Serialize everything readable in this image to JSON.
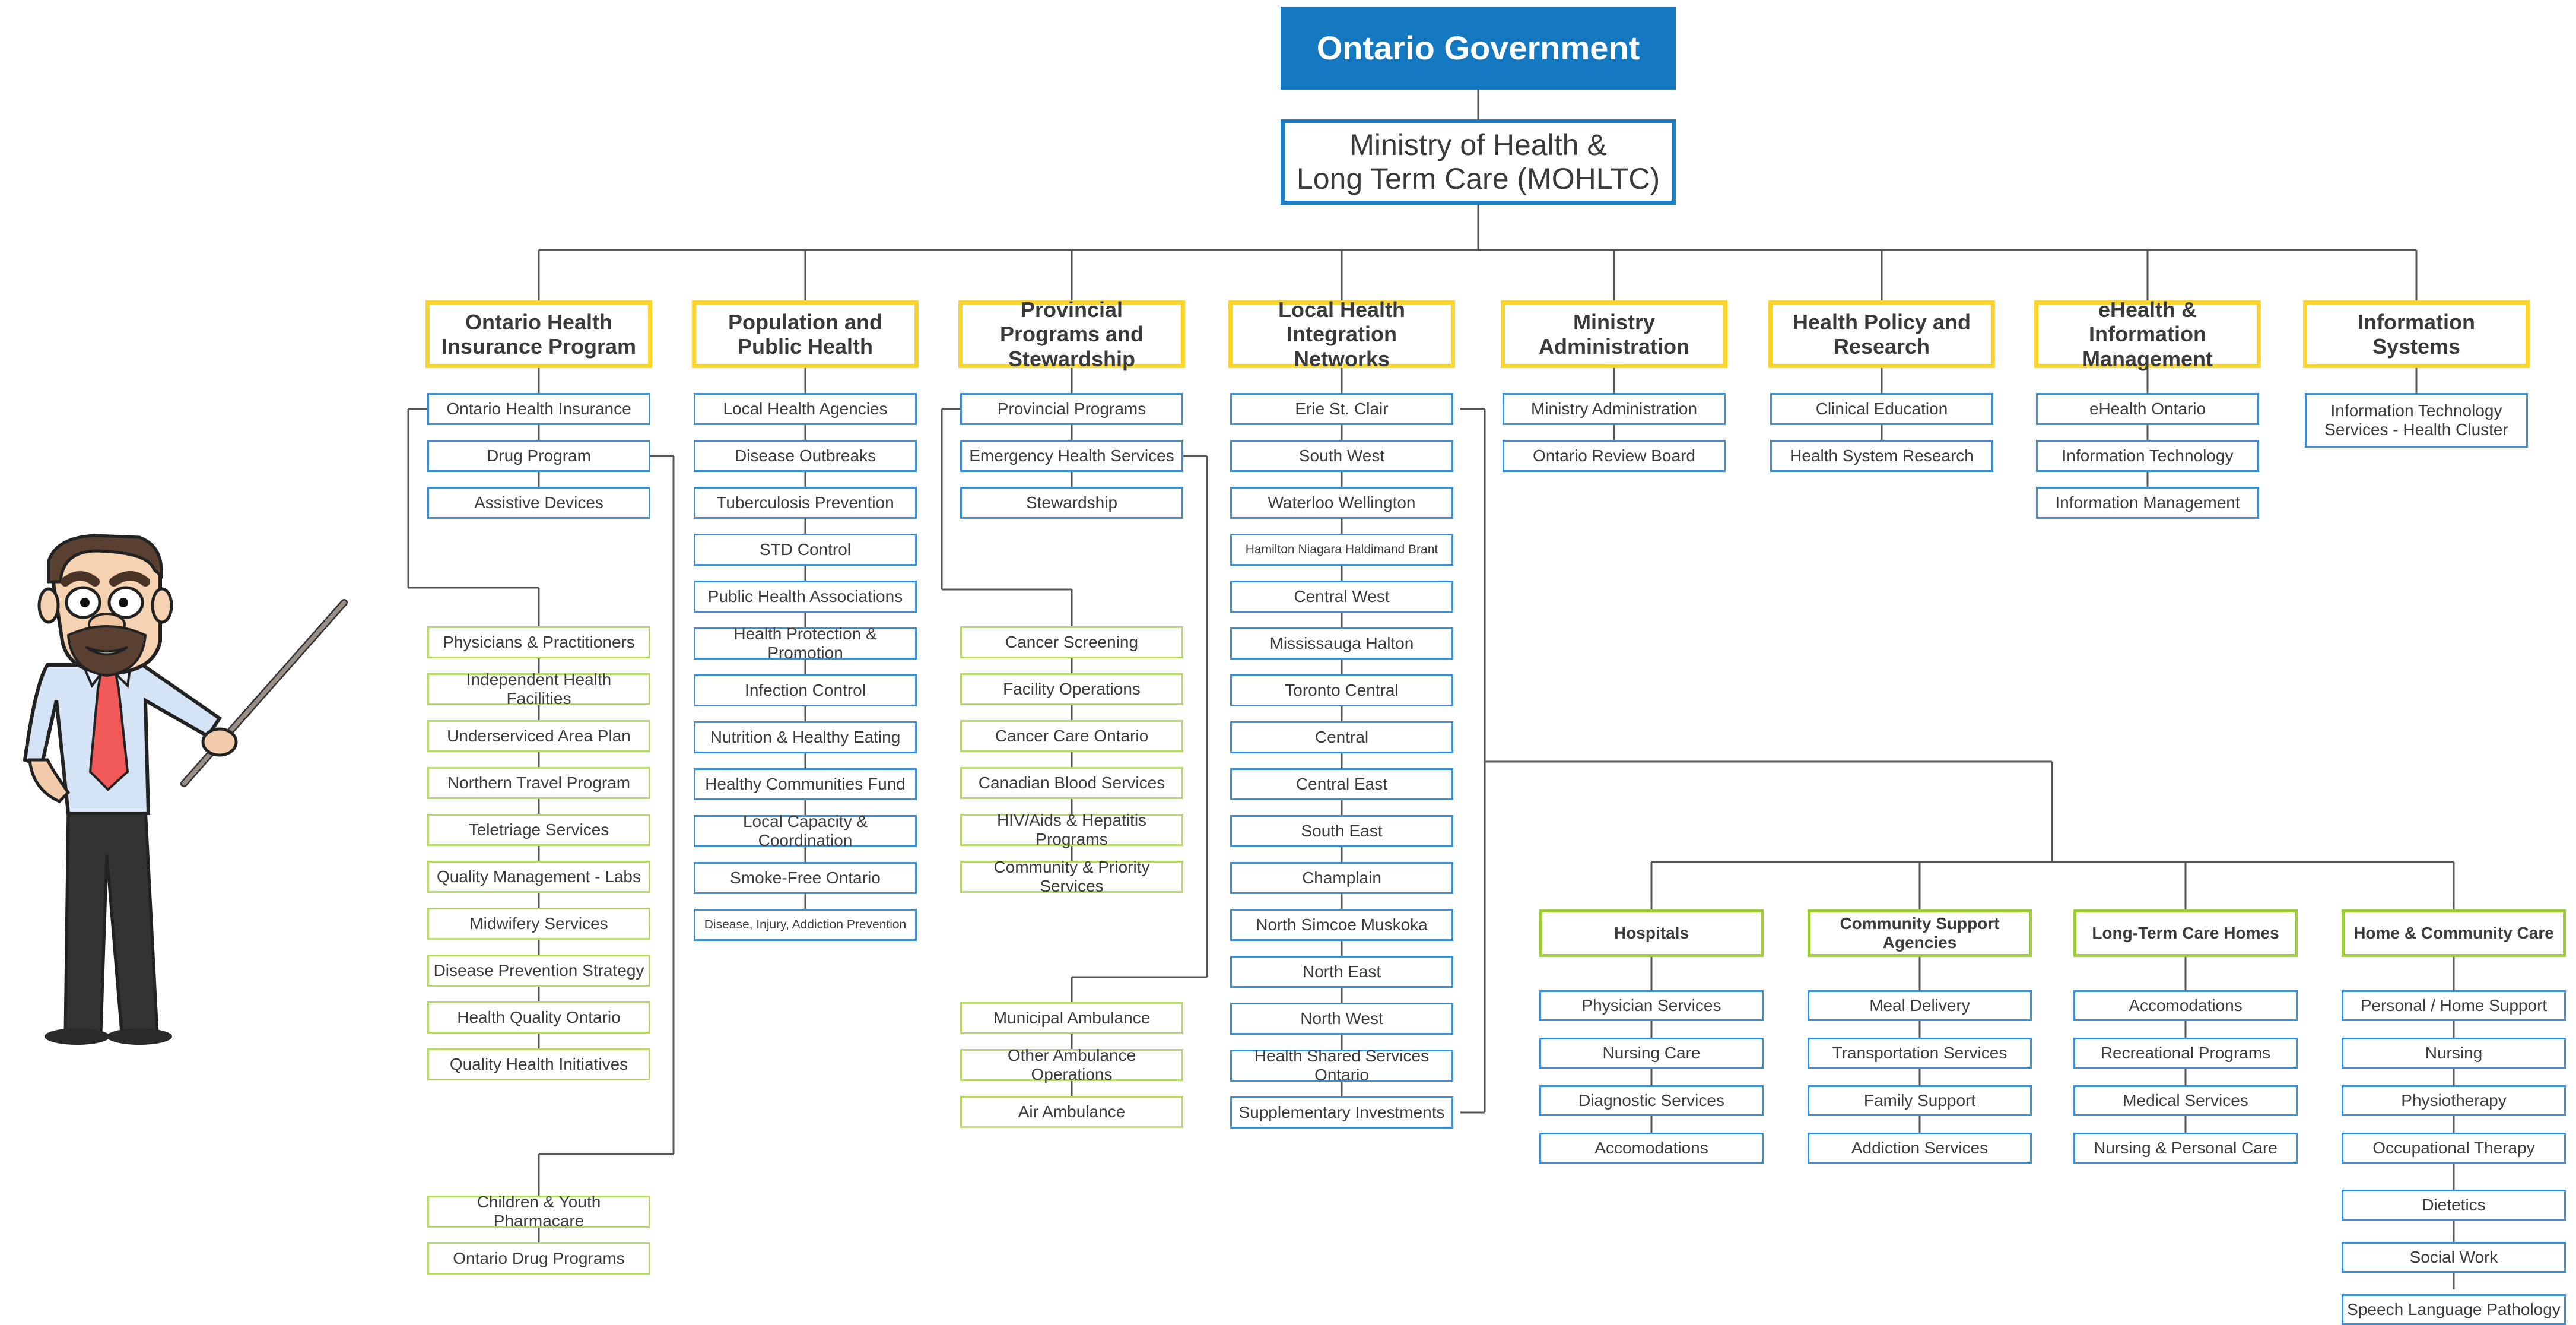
{
  "root": {
    "label": "Ontario Government"
  },
  "ministry": {
    "label": "Ministry of Health & Long Term Care (MOHLTC)",
    "line1": "Ministry of Health &",
    "line2": "Long Term Care (MOHLTC)"
  },
  "colors": {
    "root_fill": "#1479c1",
    "ministry_border": "#1f7fc4",
    "tier1_border": "#fbd52e",
    "leaf_blue_border": "#3d8fd1",
    "leaf_green_border": "#b6d96a",
    "subgroup_border": "#9fcd3a",
    "connector": "#555555"
  },
  "divisions": [
    {
      "label": "Ontario Health Insurance Program",
      "children": [
        "Ontario Health Insurance",
        "Drug Program",
        "Assistive Devices"
      ],
      "ohi_programs": [
        "Physicians & Practitioners",
        "Independent Health Facilities",
        "Underserviced Area Plan",
        "Northern Travel Program",
        "Teletriage Services",
        "Quality Management - Labs",
        "Midwifery Services",
        "Disease Prevention Strategy",
        "Health Quality Ontario",
        "Quality Health Initiatives"
      ],
      "drug_programs": [
        "Children & Youth Pharmacare",
        "Ontario Drug Programs"
      ]
    },
    {
      "label": "Population and Public Health",
      "children": [
        "Local Health Agencies",
        "Disease Outbreaks",
        "Tuberculosis Prevention",
        "STD Control",
        "Public Health Associations",
        "Health Protection & Promotion",
        "Infection Control",
        "Nutrition & Healthy Eating",
        "Healthy Communities Fund",
        "Local Capacity & Coordination",
        "Smoke-Free Ontario",
        "Disease, Injury, Addiction Prevention"
      ]
    },
    {
      "label": "Provincial Programs and Stewardship",
      "children": [
        "Provincial Programs",
        "Emergency Health Services",
        "Stewardship"
      ],
      "provincial_programs": [
        "Cancer Screening",
        "Facility Operations",
        "Cancer Care Ontario",
        "Canadian Blood Services",
        "HIV/Aids & Hepatitis Programs",
        "Community & Priority Services"
      ],
      "emergency_services": [
        "Municipal Ambulance",
        "Other Ambulance Operations",
        "Air Ambulance"
      ]
    },
    {
      "label": "Local Health Integration Networks",
      "children": [
        "Erie St. Clair",
        "South West",
        "Waterloo Wellington",
        "Hamilton Niagara Haldimand Brant",
        "Central West",
        "Mississauga Halton",
        "Toronto Central",
        "Central",
        "Central East",
        "South East",
        "Champlain",
        "North Simcoe Muskoka",
        "North East",
        "North West",
        "Health Shared Services Ontario",
        "Supplementary Investments"
      ]
    },
    {
      "label": "Ministry Administration",
      "children": [
        "Ministry Administration",
        "Ontario Review Board"
      ]
    },
    {
      "label": "Health Policy and Research",
      "children": [
        "Clinical Education",
        "Health System Research"
      ]
    },
    {
      "label": "eHealth & Information Management",
      "children": [
        "eHealth Ontario",
        "Information Technology",
        "Information Management"
      ]
    },
    {
      "label": "Information Systems",
      "children": [
        "Information Technology Services - Health Cluster"
      ]
    }
  ],
  "lhin_services": [
    {
      "label": "Hospitals",
      "children": [
        "Physician Services",
        "Nursing Care",
        "Diagnostic Services",
        "Accomodations"
      ]
    },
    {
      "label": "Community Support Agencies",
      "children": [
        "Meal Delivery",
        "Transportation Services",
        "Family Support",
        "Addiction Services"
      ]
    },
    {
      "label": "Long-Term Care Homes",
      "children": [
        "Accomodations",
        "Recreational Programs",
        "Medical Services",
        "Nursing & Personal Care"
      ]
    },
    {
      "label": "Home & Community Care",
      "children": [
        "Personal / Home Support",
        "Nursing",
        "Physiotherapy",
        "Occupational Therapy",
        "Dietetics",
        "Social Work",
        "Speech Language Pathology"
      ]
    }
  ],
  "illustration": {
    "icon": "presenter-character-icon"
  }
}
